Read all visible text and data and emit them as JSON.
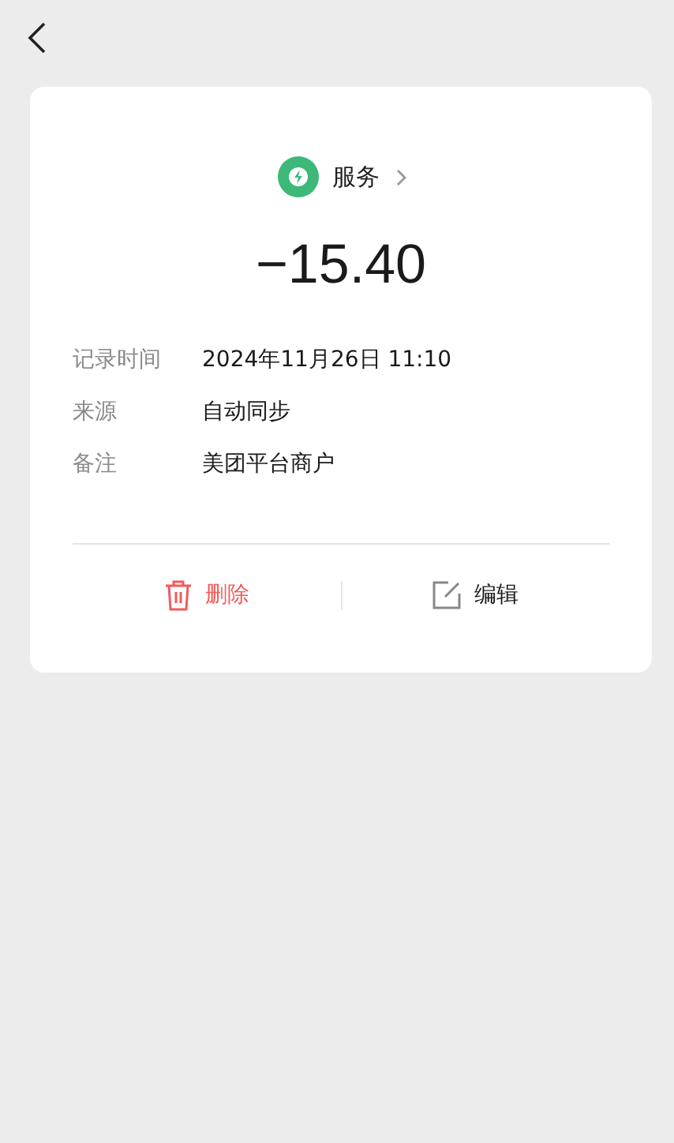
{
  "category": {
    "label": "服务",
    "color": "#3cb878"
  },
  "amount": "−15.40",
  "details": [
    {
      "label": "记录时间",
      "value": "2024年11月26日 11:10"
    },
    {
      "label": "来源",
      "value": "自动同步"
    },
    {
      "label": "备注",
      "value": "美团平台商户"
    }
  ],
  "actions": [
    {
      "kind": "delete",
      "label": "删除"
    },
    {
      "kind": "edit",
      "label": "编辑"
    }
  ]
}
